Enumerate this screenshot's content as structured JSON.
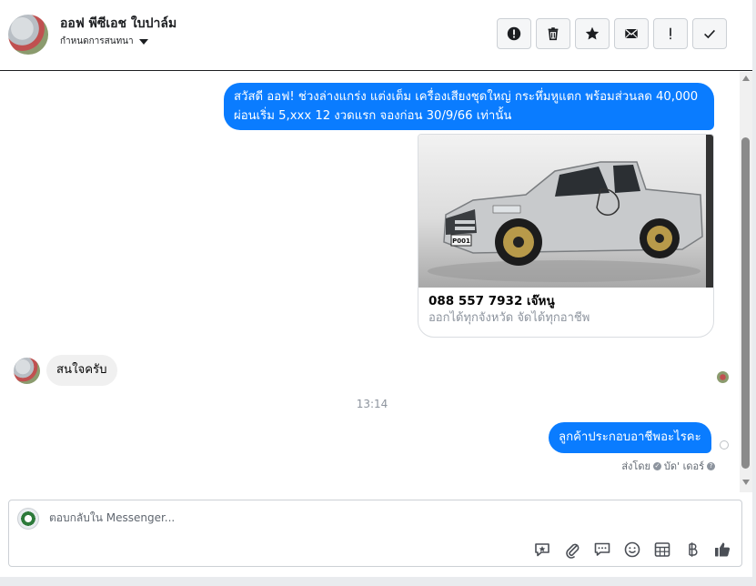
{
  "header": {
    "contact_name": "ออฟ พีซีเอช ใบปาล์ม",
    "assign_label": "กำหนดการสนทนา",
    "toolbar": [
      {
        "icon": "alert-circle-icon",
        "label": ""
      },
      {
        "icon": "trash-icon",
        "label": ""
      },
      {
        "icon": "star-icon",
        "label": ""
      },
      {
        "icon": "envelope-icon",
        "label": ""
      },
      {
        "icon": "exclamation-icon",
        "label": ""
      },
      {
        "icon": "checkmark-icon",
        "label": ""
      }
    ]
  },
  "messages": {
    "outgoing_1": {
      "line1": "สวัสดี ออฟ! ช่วงล่างแกร่ง แต่งเต็ม เครื่องเสียงชุดใหญ่ กระหึ่มหูแตก พร้อมส่วนลด 40,000",
      "line2": "ผ่อนเริ่ม 5,xxx 12 งวดแรก  จองก่อน 30/9/66 เท่านั้น"
    },
    "card": {
      "image_icon": "pickup-truck-photo",
      "plate_text": "P001",
      "title": "088 557 7932 เจ๊หนู",
      "subtitle": "ออกได้ทุกจังหวัด จัดได้ทุกอาชีพ"
    },
    "incoming_1": "สนใจครับ",
    "timestamp": "13:14",
    "outgoing_2": "ลูกค้าประกอบอาชีพอะไรคะ",
    "sent_by_label": "ส่งโดย",
    "sent_by_name": "บัด' เดอร์"
  },
  "composer": {
    "placeholder": "ตอบกลับใน Messenger...",
    "tools": [
      "saved-reply-icon",
      "paperclip-icon",
      "chat-bubbles-icon",
      "emoji-icon",
      "table-icon",
      "baht-icon",
      "thumbs-up-icon"
    ]
  },
  "colors": {
    "outgoing_bubble": "#0a7cff",
    "incoming_bubble": "#f0f0f0",
    "muted_text": "#8d949e"
  }
}
